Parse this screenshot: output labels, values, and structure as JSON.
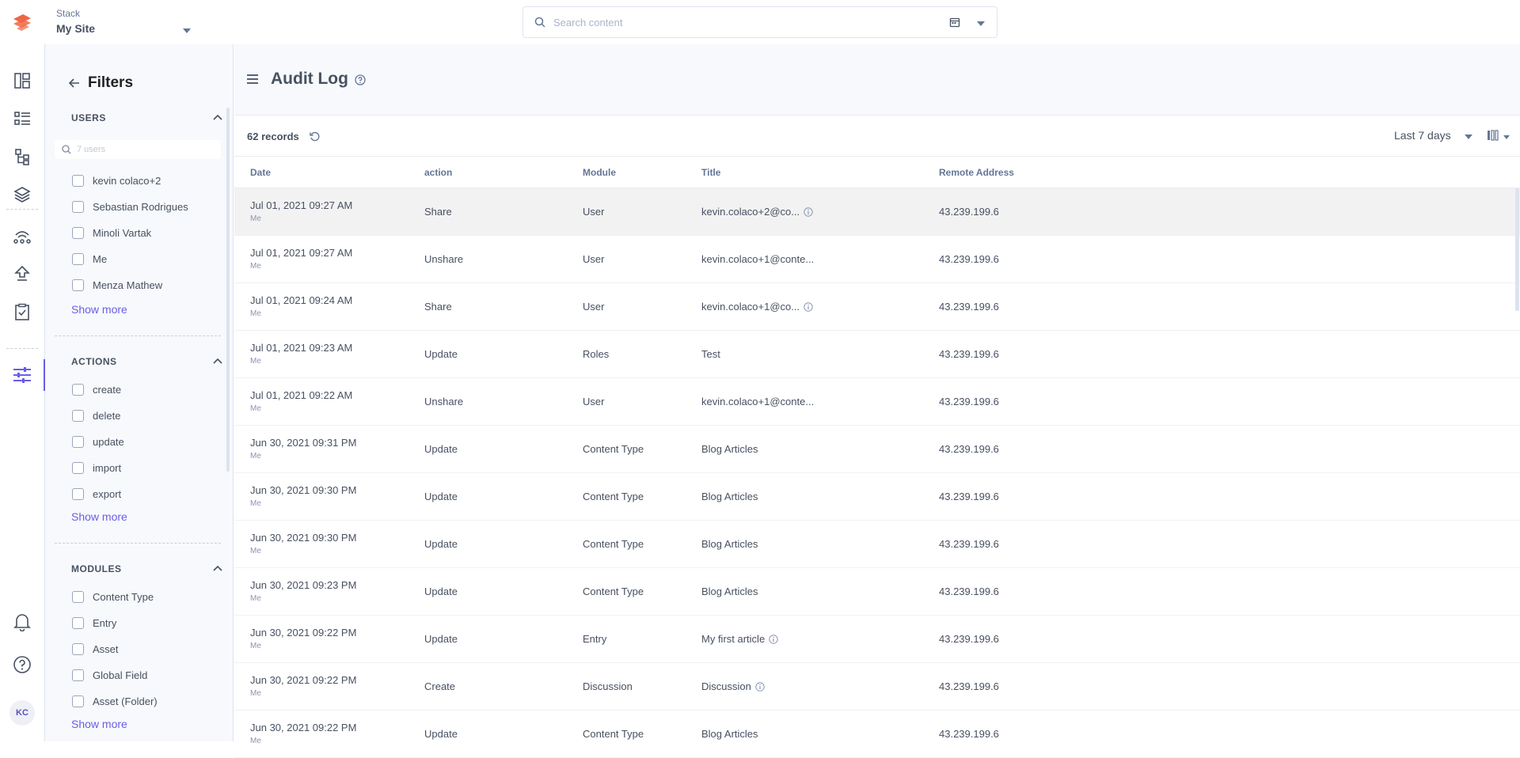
{
  "header": {
    "stack_label": "Stack",
    "stack_name": "My Site",
    "search_placeholder": "Search content"
  },
  "rail": {
    "avatar_initials": "KC"
  },
  "filters": {
    "title": "Filters",
    "users": {
      "heading": "USERS",
      "search_placeholder": "7 users",
      "items": [
        "kevin colaco+2",
        "Sebastian Rodrigues",
        "Minoli Vartak",
        "Me",
        "Menza Mathew"
      ],
      "show_more": "Show more"
    },
    "actions": {
      "heading": "ACTIONS",
      "items": [
        "create",
        "delete",
        "update",
        "import",
        "export"
      ],
      "show_more": "Show more"
    },
    "modules": {
      "heading": "MODULES",
      "items": [
        "Content Type",
        "Entry",
        "Asset",
        "Global Field",
        "Asset (Folder)"
      ],
      "show_more": "Show more"
    }
  },
  "main": {
    "title": "Audit Log",
    "records": "62 records",
    "range": "Last 7 days",
    "columns": [
      "Date",
      "action",
      "Module",
      "Title",
      "Remote Address"
    ],
    "rows": [
      {
        "date": "Jul 01, 2021 09:27 AM",
        "user": "Me",
        "action": "Share",
        "module": "User",
        "title": "kevin.colaco+2@co...",
        "info": true,
        "ip": "43.239.199.6"
      },
      {
        "date": "Jul 01, 2021 09:27 AM",
        "user": "Me",
        "action": "Unshare",
        "module": "User",
        "title": "kevin.colaco+1@conte...",
        "info": false,
        "ip": "43.239.199.6"
      },
      {
        "date": "Jul 01, 2021 09:24 AM",
        "user": "Me",
        "action": "Share",
        "module": "User",
        "title": "kevin.colaco+1@co...",
        "info": true,
        "ip": "43.239.199.6"
      },
      {
        "date": "Jul 01, 2021 09:23 AM",
        "user": "Me",
        "action": "Update",
        "module": "Roles",
        "title": "Test",
        "info": false,
        "ip": "43.239.199.6"
      },
      {
        "date": "Jul 01, 2021 09:22 AM",
        "user": "Me",
        "action": "Unshare",
        "module": "User",
        "title": "kevin.colaco+1@conte...",
        "info": false,
        "ip": "43.239.199.6"
      },
      {
        "date": "Jun 30, 2021 09:31 PM",
        "user": "Me",
        "action": "Update",
        "module": "Content Type",
        "title": "Blog Articles",
        "info": false,
        "ip": "43.239.199.6"
      },
      {
        "date": "Jun 30, 2021 09:30 PM",
        "user": "Me",
        "action": "Update",
        "module": "Content Type",
        "title": "Blog Articles",
        "info": false,
        "ip": "43.239.199.6"
      },
      {
        "date": "Jun 30, 2021 09:30 PM",
        "user": "Me",
        "action": "Update",
        "module": "Content Type",
        "title": "Blog Articles",
        "info": false,
        "ip": "43.239.199.6"
      },
      {
        "date": "Jun 30, 2021 09:23 PM",
        "user": "Me",
        "action": "Update",
        "module": "Content Type",
        "title": "Blog Articles",
        "info": false,
        "ip": "43.239.199.6"
      },
      {
        "date": "Jun 30, 2021 09:22 PM",
        "user": "Me",
        "action": "Update",
        "module": "Entry",
        "title": "My first article",
        "info": true,
        "ip": "43.239.199.6"
      },
      {
        "date": "Jun 30, 2021 09:22 PM",
        "user": "Me",
        "action": "Create",
        "module": "Discussion",
        "title": "Discussion",
        "info": true,
        "ip": "43.239.199.6"
      },
      {
        "date": "Jun 30, 2021 09:22 PM",
        "user": "Me",
        "action": "Update",
        "module": "Content Type",
        "title": "Blog Articles",
        "info": false,
        "ip": "43.239.199.6"
      }
    ]
  },
  "colors": {
    "accent": "#6c5ce7",
    "logo": "#f06543",
    "text": "#475161",
    "muted": "#647696"
  }
}
